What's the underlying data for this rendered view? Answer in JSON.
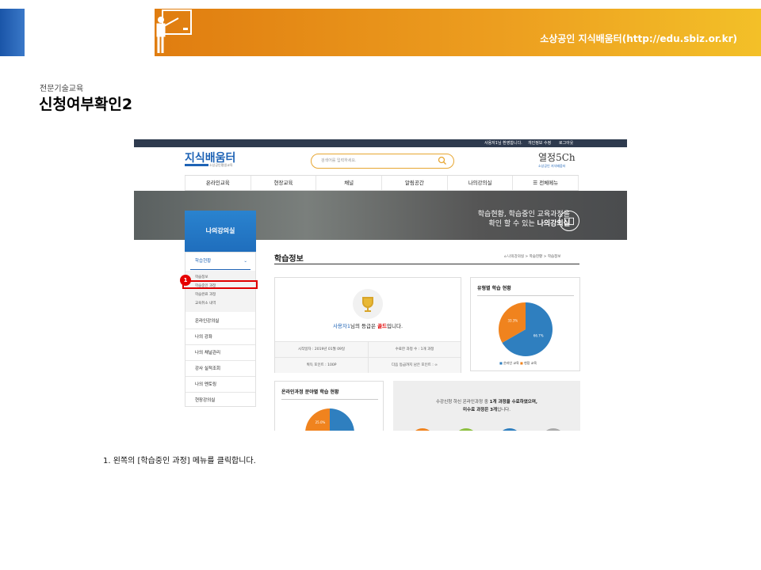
{
  "header": {
    "site_title": "소상공인 지식배움터(http://edu.sbiz.or.kr)"
  },
  "slide": {
    "kicker": "전문기술교육",
    "title": "신청여부확인2",
    "instruction": "1. 왼쪽의 [학습중인 과정] 메뉴를 클릭합니다."
  },
  "screenshot": {
    "top_links": [
      "사용자1님 환영합니다.",
      "개인정보 수정",
      "로그아웃"
    ],
    "logo": "지식배움터",
    "logo_sub": "소상공인평생교육",
    "search_placeholder": "검색어를 입력하세요.",
    "brand_right": "열정5Ch",
    "brand_right_sub": "소상공인 지식배움터",
    "nav": [
      "온라인교육",
      "현장교육",
      "채널",
      "알림공간",
      "나의강의실",
      "전체메뉴"
    ],
    "banner_line1": "학습현황, 학습중인 교육과정을",
    "banner_line2a": "확인 할 수 있는 ",
    "banner_line2b": "나의강의실",
    "sidebar_title": "나의강의실",
    "sidebar_group": "학습현황",
    "sidebar_sub": [
      "학습정보",
      "학습중인 과정",
      "학습완료 과정",
      "교육취소 내역"
    ],
    "sidebar_items": [
      "온라인강의실",
      "나의 강좌",
      "나의 채널관리",
      "강사 실적조회",
      "나의 멘토링",
      "현장강의실"
    ],
    "badge": "1",
    "main_title": "학습정보",
    "breadcrumb": "나의강의실 > 학습현황 > 학습정보",
    "grade_pre": "사용자1",
    "grade_mid": "님의 등급은 ",
    "grade_val": "골드",
    "grade_post": "입니다.",
    "info": [
      "시작일자 : 2019년 01월 09일",
      "수료한 과정 수 : 1개 과정",
      "획득 포인트 : 100P",
      "다음 등급까지 남은 포인트 : ∞"
    ],
    "chart1_title": "유형별 학습 현황",
    "chart1_pct": [
      "33.3%",
      "66.7%"
    ],
    "chart1_legend": [
      "온라인 교육",
      "현장 교육"
    ],
    "chart2_title": "온라인과정 분야별 학습 현황",
    "chart2_pct": "25.0%",
    "summary_line1a": "수강신청 하신 온라인과정 중 ",
    "summary_line1b": "1개 과정을 수료하였으며,",
    "summary_line2a": "미수료 과정은 3개",
    "summary_line2b": "입니다."
  },
  "chart_data": [
    {
      "type": "pie",
      "title": "유형별 학습 현황",
      "categories": [
        "온라인 교육",
        "현장 교육"
      ],
      "values": [
        66.7,
        33.3
      ],
      "colors": [
        "#2f7fbf",
        "#f0831e"
      ]
    },
    {
      "type": "pie",
      "title": "온라인과정 분야별 학습 현황",
      "categories": [
        "",
        ""
      ],
      "values": [
        75.0,
        25.0
      ],
      "colors": [
        "#2f7fbf",
        "#f0831e"
      ]
    }
  ]
}
